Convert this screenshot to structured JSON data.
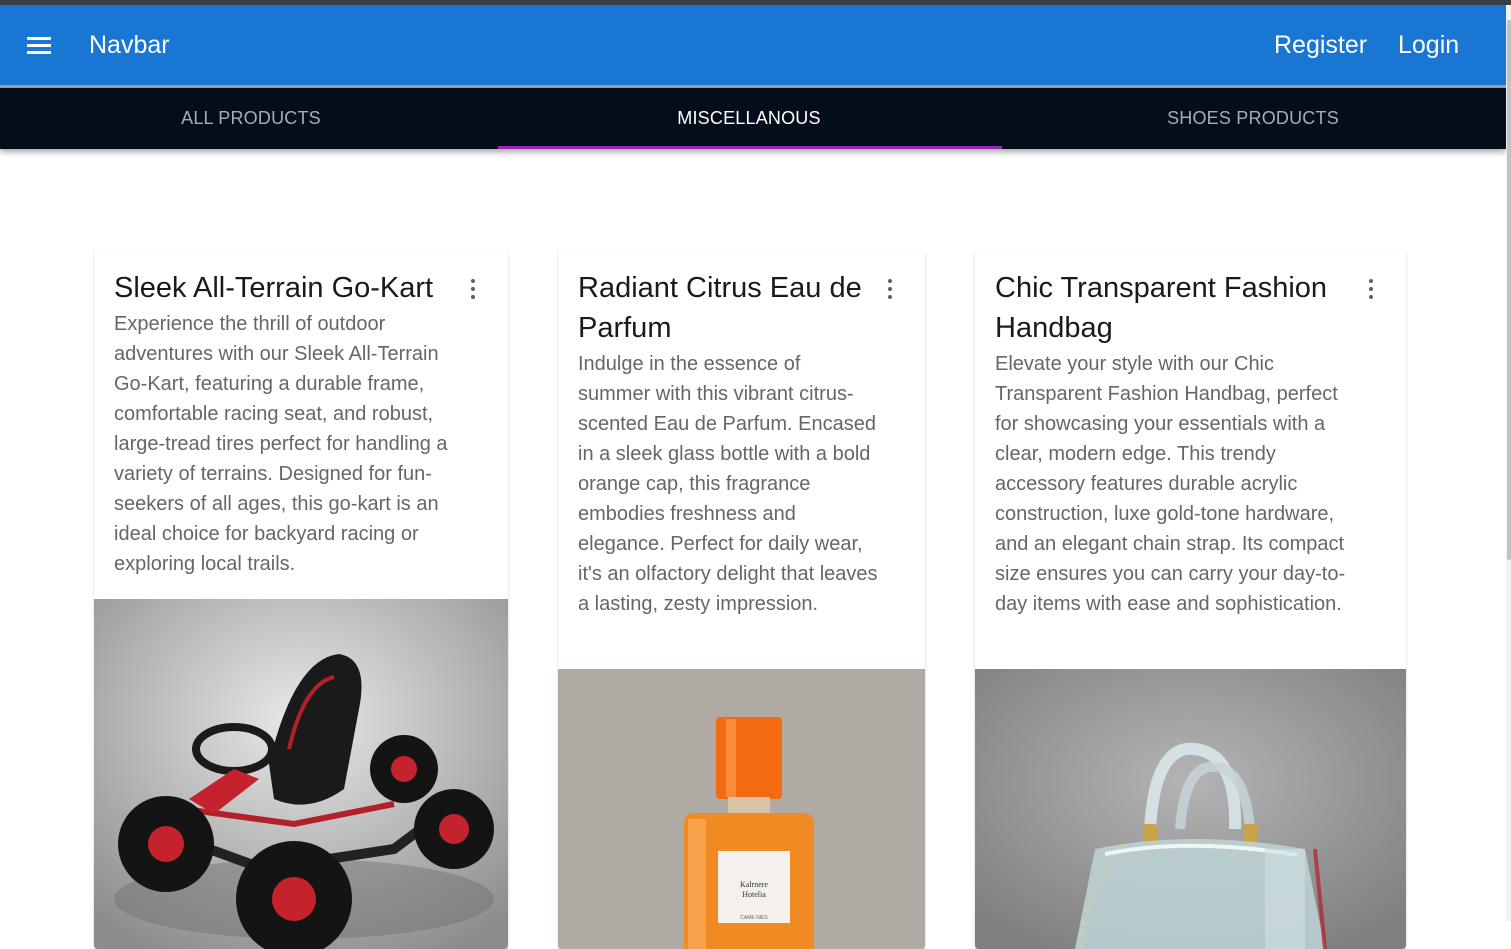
{
  "navbar": {
    "menu_icon": "menu-icon",
    "title": "Navbar",
    "register_label": "Register",
    "login_label": "Login",
    "color": "#1976d2"
  },
  "tabs": {
    "items": [
      {
        "label": "ALL PRODUCTS",
        "active": false
      },
      {
        "label": "MISCELLANOUS",
        "active": true
      },
      {
        "label": "SHOES PRODUCTS",
        "active": false
      }
    ],
    "background": "#040d1a",
    "indicator_color": "#9c27b0"
  },
  "products": [
    {
      "title": "Sleek All-Terrain Go-Kart",
      "description": "Experience the thrill of outdoor adventures with our Sleek All-Terrain Go-Kart, featuring a durable frame, comfortable racing seat, and robust, large-tread tires perfect for handling a variety of terrains. Designed for fun-seekers of all ages, this go-kart is an ideal choice for backyard racing or exploring local trails.",
      "menu_icon": "more-vert-icon",
      "image": "go-kart-image"
    },
    {
      "title": "Radiant Citrus Eau de Parfum",
      "description": "Indulge in the essence of summer with this vibrant citrus-scented Eau de Parfum. Encased in a sleek glass bottle with a bold orange cap, this fragrance embodies freshness and elegance. Perfect for daily wear, it's an olfactory delight that leaves a lasting, zesty impression.",
      "menu_icon": "more-vert-icon",
      "image": "perfume-bottle-image"
    },
    {
      "title": "Chic Transparent Fashion Handbag",
      "description": "Elevate your style with our Chic Transparent Fashion Handbag, perfect for showcasing your essentials with a clear, modern edge. This trendy accessory features durable acrylic construction, luxe gold-tone hardware, and an elegant chain strap. Its compact size ensures you can carry your day-to-day items with ease and sophistication.",
      "menu_icon": "more-vert-icon",
      "image": "handbag-image"
    }
  ]
}
